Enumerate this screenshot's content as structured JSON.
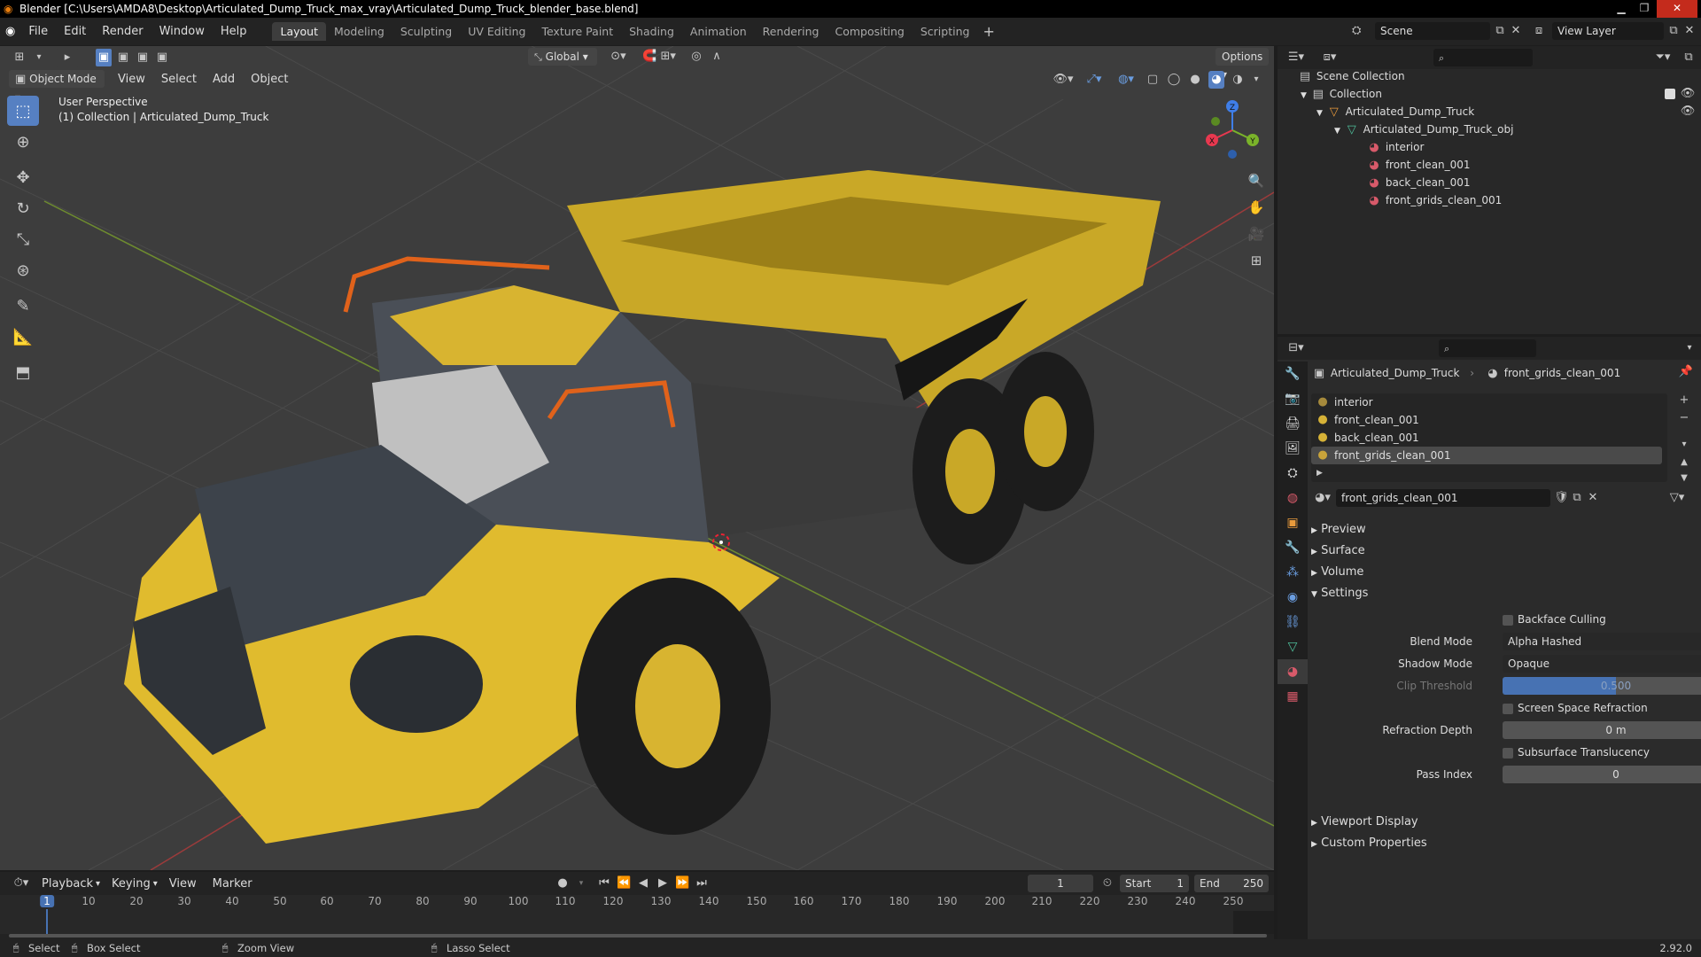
{
  "window": {
    "title": "Blender [C:\\Users\\AMDA8\\Desktop\\Articulated_Dump_Truck_max_vray\\Articulated_Dump_Truck_blender_base.blend]"
  },
  "menu": [
    "File",
    "Edit",
    "Render",
    "Window",
    "Help"
  ],
  "workspaces": [
    "Layout",
    "Modeling",
    "Sculpting",
    "UV Editing",
    "Texture Paint",
    "Shading",
    "Animation",
    "Rendering",
    "Compositing",
    "Scripting"
  ],
  "scene": {
    "name": "Scene",
    "view_layer": "View Layer"
  },
  "viewport": {
    "transform": "Global",
    "options": "Options",
    "mode": "Object Mode",
    "menu": [
      "View",
      "Select",
      "Add",
      "Object"
    ],
    "overlay_title": "User Perspective",
    "overlay_sub": "(1) Collection | Articulated_Dump_Truck"
  },
  "gizmo": {
    "x": "X",
    "y": "Y",
    "z": "Z"
  },
  "outliner": {
    "scene_collection": "Scene Collection",
    "collection": "Collection",
    "object": "Articulated_Dump_Truck",
    "mesh": "Articulated_Dump_Truck_obj",
    "materials": [
      "interior",
      "front_clean_001",
      "back_clean_001",
      "front_grids_clean_001"
    ]
  },
  "properties": {
    "object": "Articulated_Dump_Truck",
    "material": "front_grids_clean_001",
    "slots": [
      "interior",
      "front_clean_001",
      "back_clean_001",
      "front_grids_clean_001"
    ],
    "material_field": "front_grids_clean_001",
    "panels": {
      "preview": "Preview",
      "surface": "Surface",
      "volume": "Volume",
      "settings": "Settings",
      "viewport_display": "Viewport Display",
      "custom_props": "Custom Properties"
    },
    "settings": {
      "backface": "Backface Culling",
      "blend_label": "Blend Mode",
      "blend_val": "Alpha Hashed",
      "shadow_label": "Shadow Mode",
      "shadow_val": "Opaque",
      "clip_label": "Clip Threshold",
      "clip_val": "0.500",
      "ssr": "Screen Space Refraction",
      "refr_label": "Refraction Depth",
      "refr_val": "0 m",
      "sst": "Subsurface Translucency",
      "pass_label": "Pass Index",
      "pass_val": "0"
    }
  },
  "timeline": {
    "menus": [
      "Playback",
      "Keying",
      "View",
      "Marker"
    ],
    "current": "1",
    "start_label": "Start",
    "start": "1",
    "end_label": "End",
    "end": "250",
    "frames": [
      "1",
      "10",
      "20",
      "30",
      "40",
      "50",
      "60",
      "70",
      "80",
      "90",
      "100",
      "110",
      "120",
      "130",
      "140",
      "150",
      "160",
      "170",
      "180",
      "190",
      "200",
      "210",
      "220",
      "230",
      "240",
      "250"
    ]
  },
  "status": {
    "select": "Select",
    "box": "Box Select",
    "zoom": "Zoom View",
    "lasso": "Lasso Select",
    "version": "2.92.0"
  }
}
